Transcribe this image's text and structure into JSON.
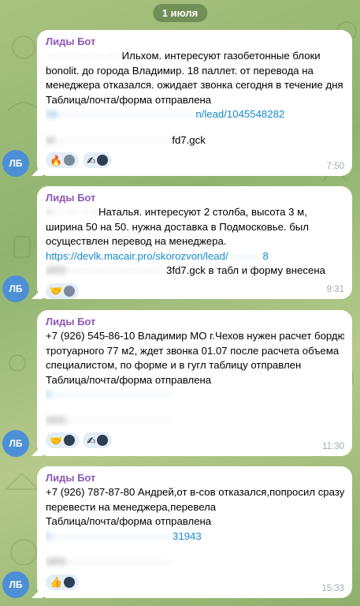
{
  "date_label": "1 июля",
  "avatar_initials": "ЛБ",
  "messages": [
    {
      "sender": "Лиды Бот",
      "lines": [
        {
          "blur": "- ·· ···· ···· ·· ··· ·",
          "text": "Ильхом. интересуют газобетонные блоки"
        },
        {
          "text": "bonolit. до города Владимир.   18 паллет.  от перевода на"
        },
        {
          "text": "менеджера отказался. ожидает звонка сегодня в течение дня"
        },
        {
          "text": "Таблица/почта/форма отправлена"
        }
      ],
      "link_blur": "htt········································",
      "link_text": "n/lead/1045548282",
      "code_blur": "bf··································",
      "code_text": "fd7.gck",
      "reactions": [
        "🔥",
        "✍"
      ],
      "time": "7:50"
    },
    {
      "sender": "Лиды Бот",
      "lines": [
        {
          "blur": "+···· ··· ·· ··",
          "text": "Наталья. интересуют 2 столба, высота 3 м,"
        },
        {
          "text": "ширина 50 на 50.  нужна доставка в Подмосковье.  был"
        },
        {
          "text": "осуществлен перевод на менеджера."
        }
      ],
      "link_text": "https://devlk.macair.pro/skorozvon/lead/",
      "link_blur_tail": "··········",
      "link_tail": "8",
      "code_blur": "bf05·····························",
      "code_text": "3fd7.gck в табл и форму внесена",
      "reactions": [
        "🤝"
      ],
      "time": "9:31"
    },
    {
      "sender": "Лиды Бот",
      "lines": [
        {
          "text": "+7 (926) 545-86-10 Владимир МО г.Чехов нужен расчет бордюра"
        },
        {
          "text": "тротуарного 77 м2, ждет звонка 01.07 после расчета объема"
        },
        {
          "text": "специалистом, по форме и в гугл таблицу отправлен"
        },
        {
          "text": "Таблица/почта/форма отправлена"
        }
      ],
      "link_blur": "h···································",
      "code_blur": "bf05······························",
      "reactions": [
        "🤝",
        "✍"
      ],
      "time": "11:30"
    },
    {
      "sender": "Лиды Бот",
      "lines": [
        {
          "text": "+7 (926) 787-87-80 Андрей,от в-сов отказался,попросил сразу"
        },
        {
          "text": "перевести на менеджера,перевела"
        },
        {
          "text": "Таблица/почта/форма отправлена"
        }
      ],
      "link_blur": "h···································",
      "link_tail": "31943",
      "code_blur": "bf05······························",
      "reactions": [
        "👍"
      ],
      "time": "15:33"
    }
  ]
}
